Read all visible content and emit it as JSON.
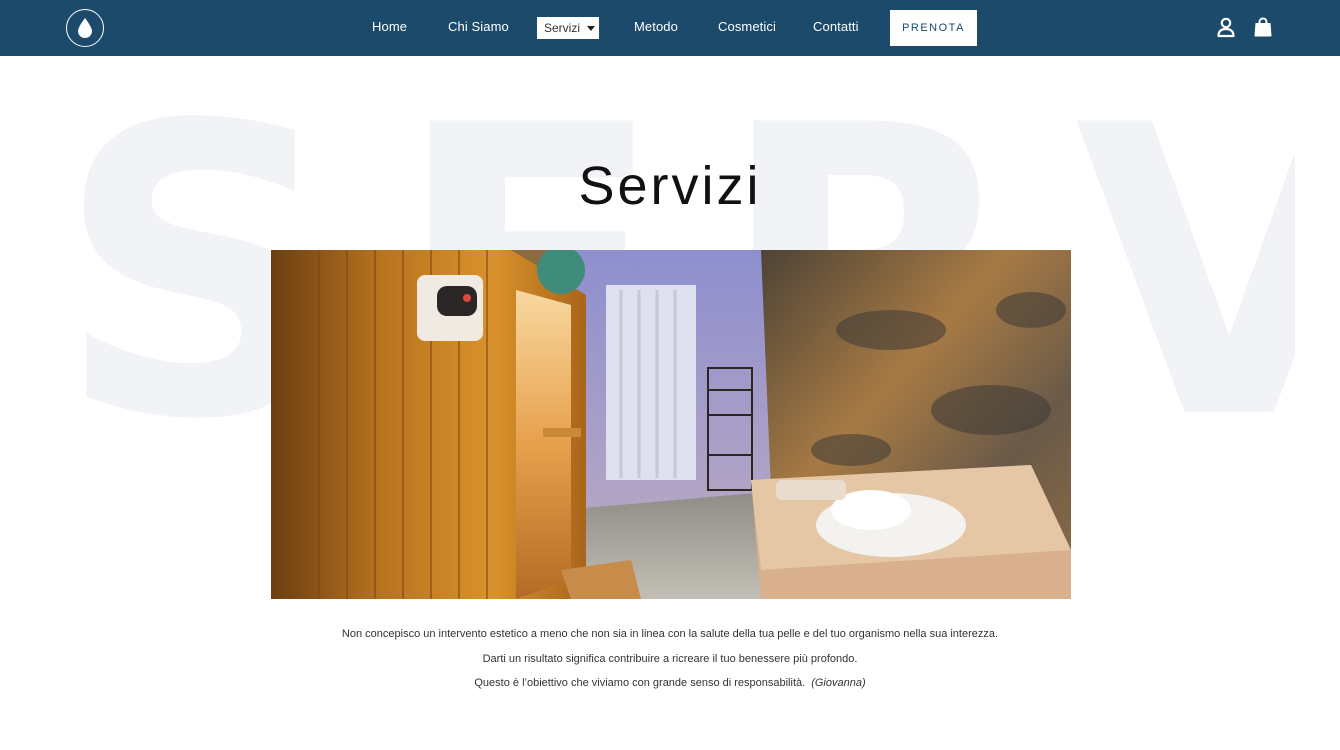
{
  "navbar": {
    "logo_icon": "water-drop-icon",
    "links": [
      "Home",
      "Chi Siamo",
      "Servizi",
      "Metodo",
      "Cosmetici",
      "Contatti"
    ],
    "cta": "PRENOTA",
    "account_icon": "user-icon",
    "cart_icon": "shopping-bag-icon",
    "background": "#1b4a6b"
  },
  "hero": {
    "watermark": "SERVIZI",
    "title": "Servizi",
    "image_icon": "spa-room-photo"
  },
  "intro": {
    "line1": "Non concepisco un intervento estetico a meno che non sia in linea con la salute della tua pelle e del tuo organismo nella sua interezza.",
    "line2": "Darti un risultato significa contribuire a ricreare il tuo benessere più profondo.",
    "line3": "Questo è l’obiettivo che viviamo con grande senso di responsabilità.",
    "signature": "(Giovanna)"
  }
}
